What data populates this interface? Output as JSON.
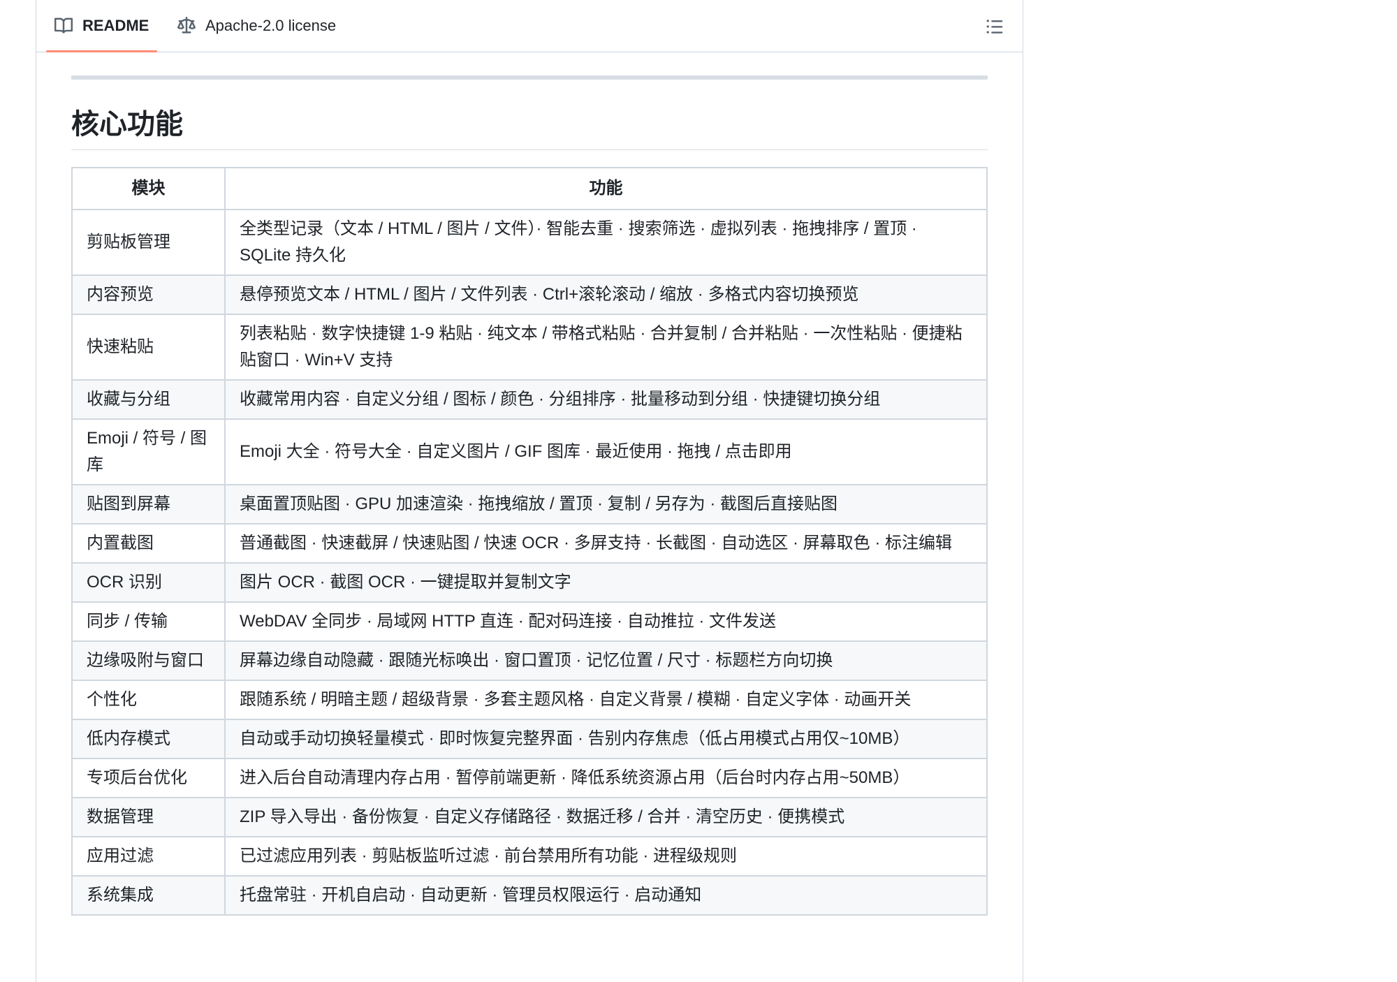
{
  "tabs": {
    "readme_label": "README",
    "license_label": "Apache-2.0 license",
    "readme_icon": "book-icon",
    "license_icon": "law-icon",
    "outline_icon": "list-unordered-icon"
  },
  "readme": {
    "heading": "核心功能",
    "table": {
      "headers": [
        "模块",
        "功能"
      ],
      "rows": [
        [
          "剪贴板管理",
          "全类型记录（文本 / HTML / 图片 / 文件）· 智能去重 · 搜索筛选 · 虚拟列表 · 拖拽排序 / 置顶 · SQLite 持久化"
        ],
        [
          "内容预览",
          "悬停预览文本 / HTML / 图片 / 文件列表 · Ctrl+滚轮滚动 / 缩放 · 多格式内容切换预览"
        ],
        [
          "快速粘贴",
          "列表粘贴 · 数字快捷键 1-9 粘贴 · 纯文本 / 带格式粘贴 · 合并复制 / 合并粘贴 · 一次性粘贴 · 便捷粘贴窗口 · Win+V 支持"
        ],
        [
          "收藏与分组",
          "收藏常用内容 · 自定义分组 / 图标 / 颜色 · 分组排序 · 批量移动到分组 · 快捷键切换分组"
        ],
        [
          "Emoji / 符号 / 图库",
          "Emoji 大全 · 符号大全 · 自定义图片 / GIF 图库 · 最近使用 · 拖拽 / 点击即用"
        ],
        [
          "贴图到屏幕",
          "桌面置顶贴图 · GPU 加速渲染 · 拖拽缩放 / 置顶 · 复制 / 另存为 · 截图后直接贴图"
        ],
        [
          "内置截图",
          "普通截图 · 快速截屏 / 快速贴图 / 快速 OCR · 多屏支持 · 长截图 · 自动选区 · 屏幕取色 · 标注编辑"
        ],
        [
          "OCR 识别",
          "图片 OCR · 截图 OCR · 一键提取并复制文字"
        ],
        [
          "同步 / 传输",
          "WebDAV 全同步 · 局域网 HTTP 直连 · 配对码连接 · 自动推拉 · 文件发送"
        ],
        [
          "边缘吸附与窗口",
          "屏幕边缘自动隐藏 · 跟随光标唤出 · 窗口置顶 · 记忆位置 / 尺寸 · 标题栏方向切换"
        ],
        [
          "个性化",
          "跟随系统 / 明暗主题 / 超级背景 · 多套主题风格 · 自定义背景 / 模糊 · 自定义字体 · 动画开关"
        ],
        [
          "低内存模式",
          "自动或手动切换轻量模式 · 即时恢复完整界面 · 告别内存焦虑（低占用模式占用仅~10MB）"
        ],
        [
          "专项后台优化",
          "进入后台自动清理内存占用 · 暂停前端更新 · 降低系统资源占用（后台时内存占用~50MB）"
        ],
        [
          "数据管理",
          "ZIP 导入导出 · 备份恢复 · 自定义存储路径 · 数据迁移 / 合并 · 清空历史 · 便携模式"
        ],
        [
          "应用过滤",
          "已过滤应用列表 · 剪贴板监听过滤 · 前台禁用所有功能 · 进程级规则"
        ],
        [
          "系统集成",
          "托盘常驻 · 开机自启动 · 自动更新 · 管理员权限运行 · 启动通知"
        ]
      ]
    }
  }
}
